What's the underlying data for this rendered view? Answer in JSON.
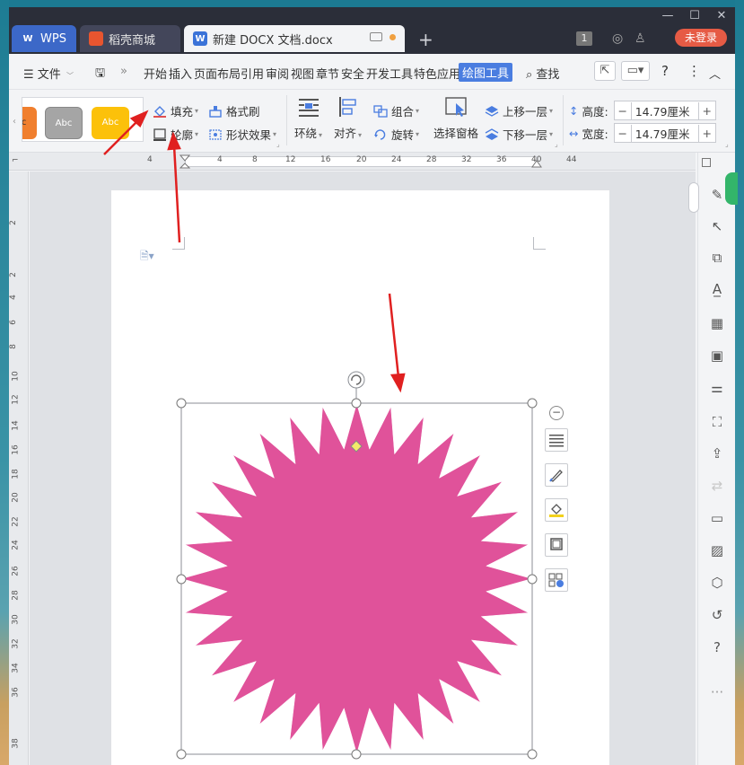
{
  "titlebar": {
    "tabs": [
      {
        "label": "WPS"
      },
      {
        "label": "稻壳商城"
      },
      {
        "label": "新建 DOCX 文档.docx"
      }
    ],
    "badge": "1",
    "login_label": "未登录"
  },
  "menubar": {
    "file_label": "文件",
    "items": [
      "开始",
      "插入",
      "页面布局",
      "引用",
      "审阅",
      "视图",
      "章节",
      "安全",
      "开发工具",
      "特色应用"
    ],
    "active_tab": "绘图工具",
    "search_label": "查找"
  },
  "ribbon": {
    "styles": [
      "Abc",
      "Abc",
      "Abc"
    ],
    "fill_label": "填充",
    "outline_label": "轮廓",
    "format_brush_label": "格式刷",
    "shape_effect_label": "形状效果",
    "wrap_label": "环绕",
    "align_label": "对齐",
    "group_label": "组合",
    "rotate_label": "旋转",
    "selection_pane_label": "选择窗格",
    "bring_forward_label": "上移一层",
    "send_backward_label": "下移一层",
    "height_label": "高度:",
    "width_label": "宽度:",
    "height_value": "14.79厘米",
    "width_value": "14.79厘米"
  },
  "ruler": {
    "h_ticks": [
      "4",
      "4",
      "8",
      "12",
      "16",
      "20",
      "24",
      "28",
      "32",
      "36",
      "40",
      "44"
    ],
    "v_ticks": [
      "2",
      "2",
      "4",
      "6",
      "8",
      "10",
      "12",
      "14",
      "16",
      "18",
      "20",
      "22",
      "24",
      "26",
      "28",
      "30",
      "32",
      "34",
      "36",
      "38"
    ]
  },
  "shape": {
    "type": "32-point star",
    "fill_color": "#e0529a"
  },
  "colors": {
    "accent": "#4a7de0",
    "titlebar_bg": "#2b2e39",
    "annotation_arrow": "#e02020"
  }
}
